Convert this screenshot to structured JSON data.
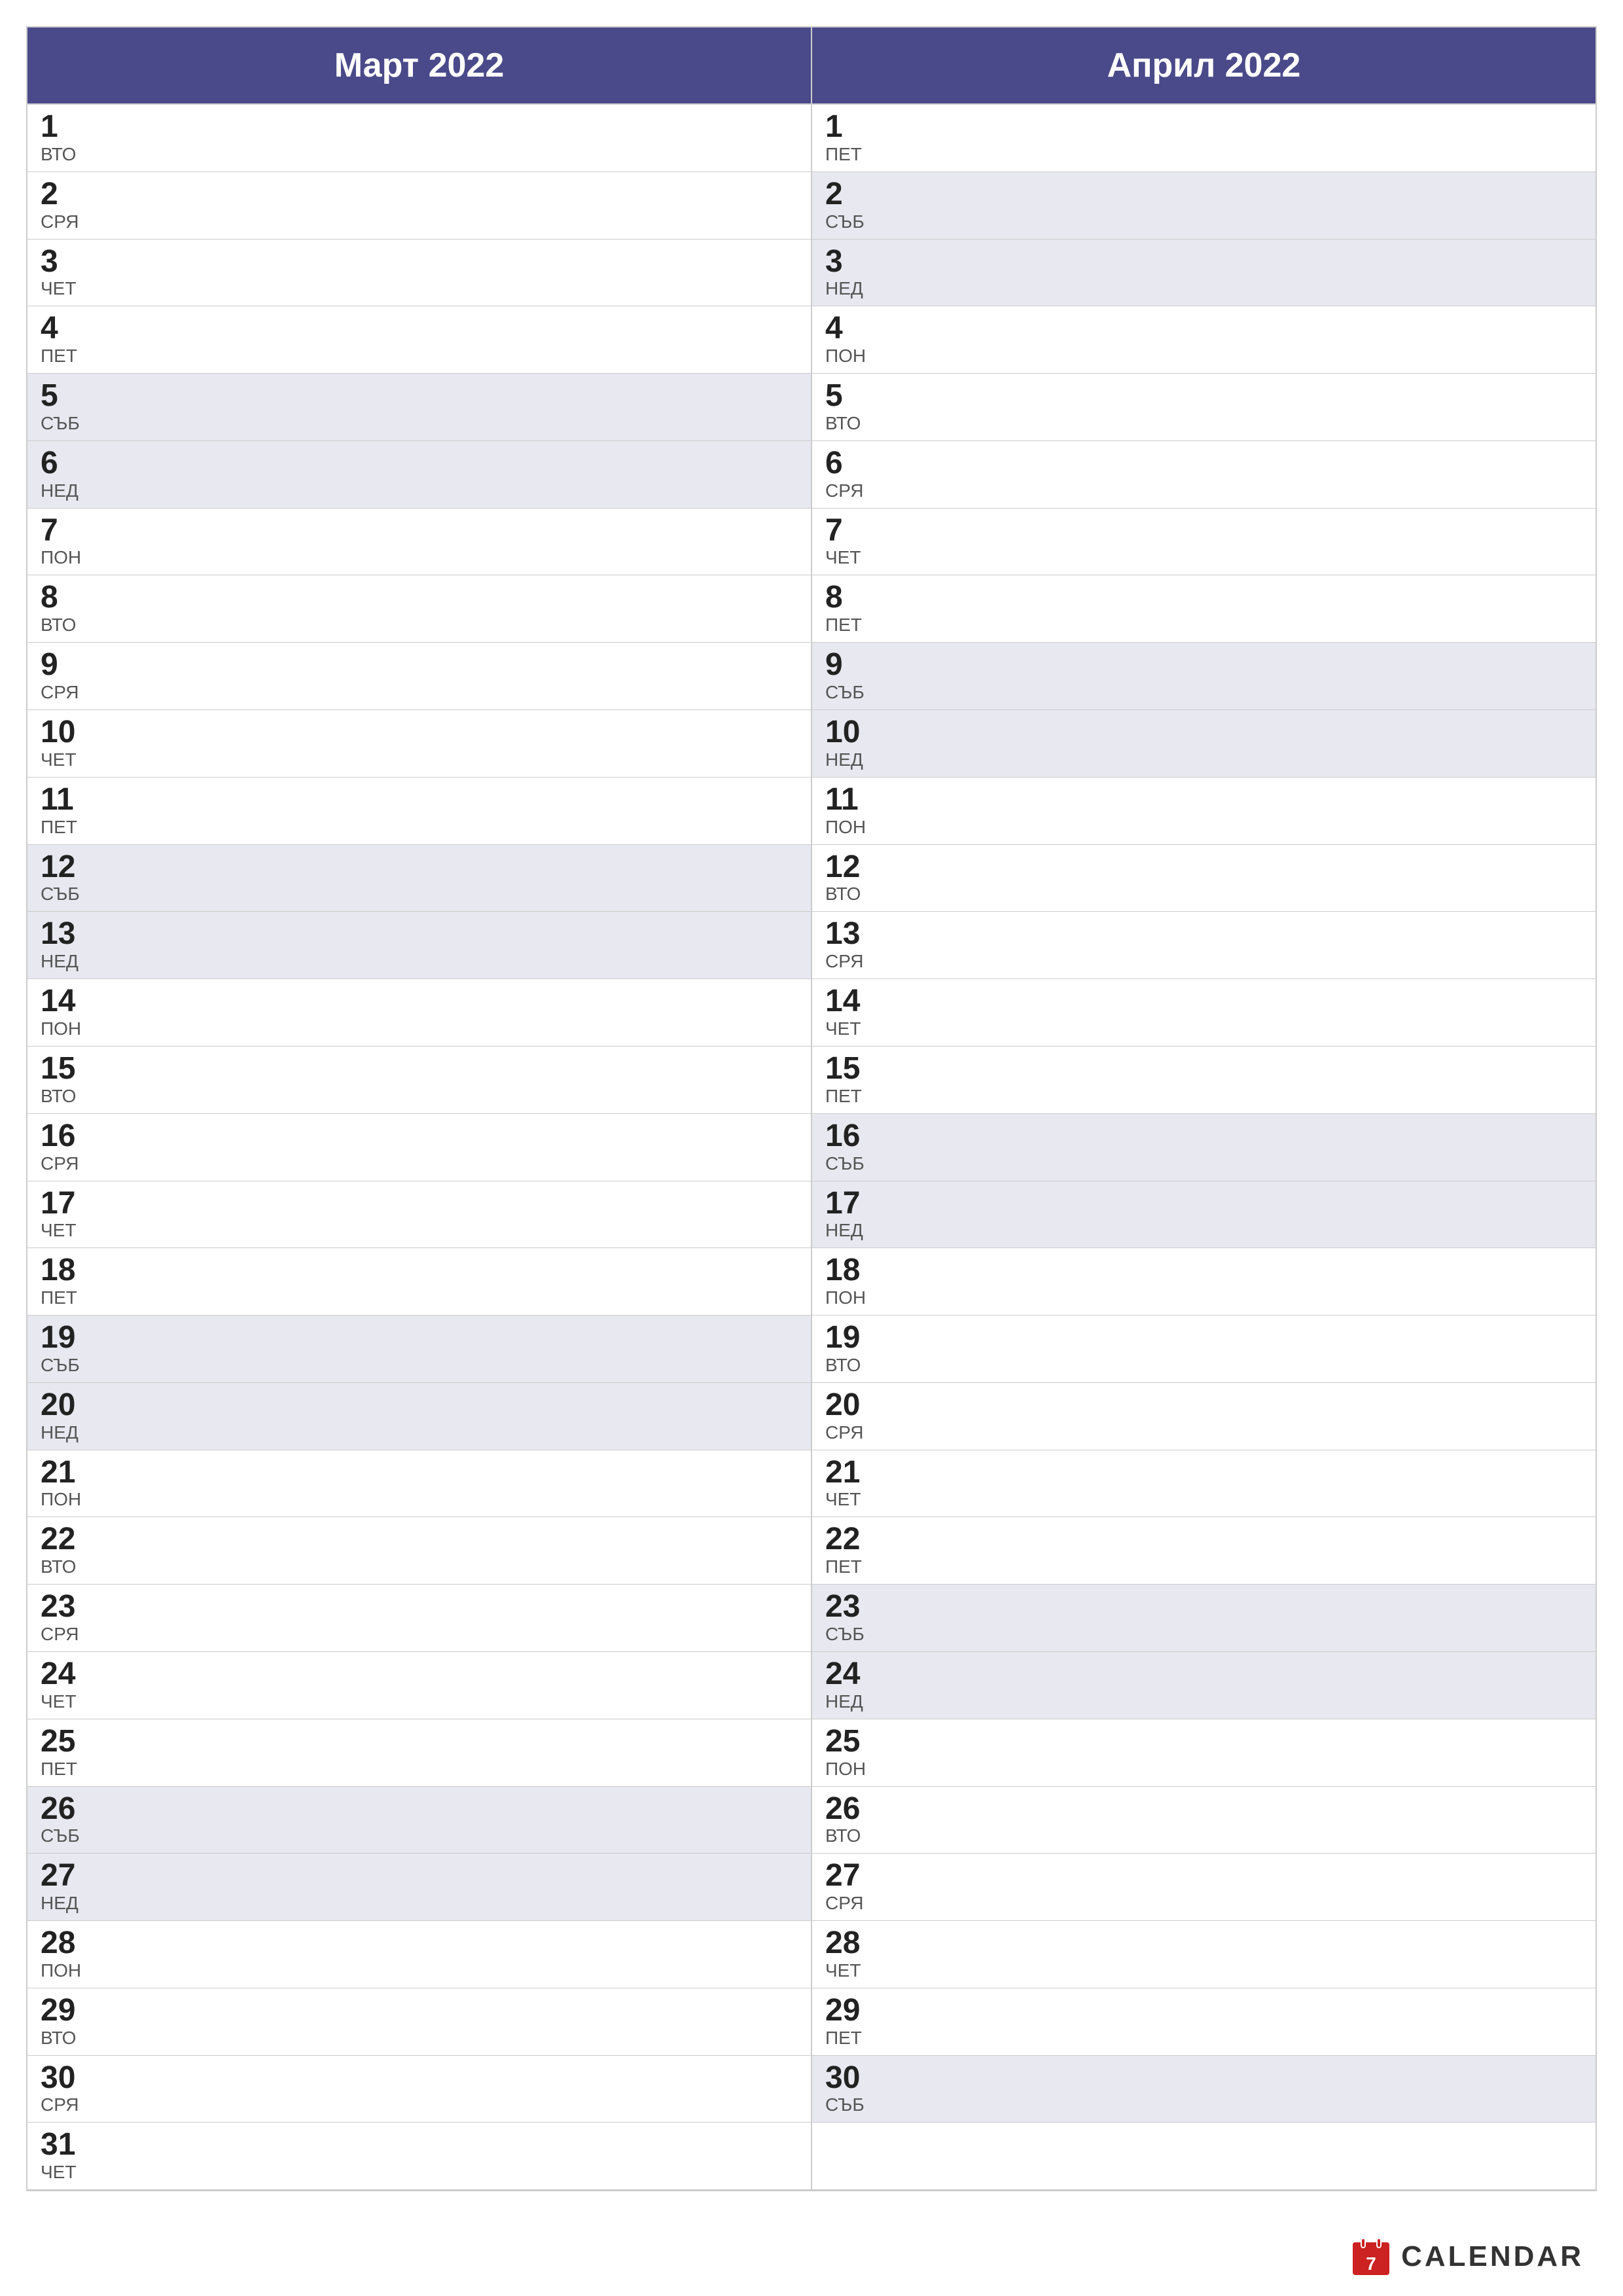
{
  "months": [
    {
      "name": "Март 2022",
      "days": [
        {
          "num": "1",
          "name": "ВТО",
          "weekend": false
        },
        {
          "num": "2",
          "name": "СРЯ",
          "weekend": false
        },
        {
          "num": "3",
          "name": "ЧЕТ",
          "weekend": false
        },
        {
          "num": "4",
          "name": "ПЕТ",
          "weekend": false
        },
        {
          "num": "5",
          "name": "СЪБ",
          "weekend": true
        },
        {
          "num": "6",
          "name": "НЕД",
          "weekend": true
        },
        {
          "num": "7",
          "name": "ПОН",
          "weekend": false
        },
        {
          "num": "8",
          "name": "ВТО",
          "weekend": false
        },
        {
          "num": "9",
          "name": "СРЯ",
          "weekend": false
        },
        {
          "num": "10",
          "name": "ЧЕТ",
          "weekend": false
        },
        {
          "num": "11",
          "name": "ПЕТ",
          "weekend": false
        },
        {
          "num": "12",
          "name": "СЪБ",
          "weekend": true
        },
        {
          "num": "13",
          "name": "НЕД",
          "weekend": true
        },
        {
          "num": "14",
          "name": "ПОН",
          "weekend": false
        },
        {
          "num": "15",
          "name": "ВТО",
          "weekend": false
        },
        {
          "num": "16",
          "name": "СРЯ",
          "weekend": false
        },
        {
          "num": "17",
          "name": "ЧЕТ",
          "weekend": false
        },
        {
          "num": "18",
          "name": "ПЕТ",
          "weekend": false
        },
        {
          "num": "19",
          "name": "СЪБ",
          "weekend": true
        },
        {
          "num": "20",
          "name": "НЕД",
          "weekend": true
        },
        {
          "num": "21",
          "name": "ПОН",
          "weekend": false
        },
        {
          "num": "22",
          "name": "ВТО",
          "weekend": false
        },
        {
          "num": "23",
          "name": "СРЯ",
          "weekend": false
        },
        {
          "num": "24",
          "name": "ЧЕТ",
          "weekend": false
        },
        {
          "num": "25",
          "name": "ПЕТ",
          "weekend": false
        },
        {
          "num": "26",
          "name": "СЪБ",
          "weekend": true
        },
        {
          "num": "27",
          "name": "НЕД",
          "weekend": true
        },
        {
          "num": "28",
          "name": "ПОН",
          "weekend": false
        },
        {
          "num": "29",
          "name": "ВТО",
          "weekend": false
        },
        {
          "num": "30",
          "name": "СРЯ",
          "weekend": false
        },
        {
          "num": "31",
          "name": "ЧЕТ",
          "weekend": false
        }
      ]
    },
    {
      "name": "Април 2022",
      "days": [
        {
          "num": "1",
          "name": "ПЕТ",
          "weekend": false
        },
        {
          "num": "2",
          "name": "СЪБ",
          "weekend": true
        },
        {
          "num": "3",
          "name": "НЕД",
          "weekend": true
        },
        {
          "num": "4",
          "name": "ПОН",
          "weekend": false
        },
        {
          "num": "5",
          "name": "ВТО",
          "weekend": false
        },
        {
          "num": "6",
          "name": "СРЯ",
          "weekend": false
        },
        {
          "num": "7",
          "name": "ЧЕТ",
          "weekend": false
        },
        {
          "num": "8",
          "name": "ПЕТ",
          "weekend": false
        },
        {
          "num": "9",
          "name": "СЪБ",
          "weekend": true
        },
        {
          "num": "10",
          "name": "НЕД",
          "weekend": true
        },
        {
          "num": "11",
          "name": "ПОН",
          "weekend": false
        },
        {
          "num": "12",
          "name": "ВТО",
          "weekend": false
        },
        {
          "num": "13",
          "name": "СРЯ",
          "weekend": false
        },
        {
          "num": "14",
          "name": "ЧЕТ",
          "weekend": false
        },
        {
          "num": "15",
          "name": "ПЕТ",
          "weekend": false
        },
        {
          "num": "16",
          "name": "СЪБ",
          "weekend": true
        },
        {
          "num": "17",
          "name": "НЕД",
          "weekend": true
        },
        {
          "num": "18",
          "name": "ПОН",
          "weekend": false
        },
        {
          "num": "19",
          "name": "ВТО",
          "weekend": false
        },
        {
          "num": "20",
          "name": "СРЯ",
          "weekend": false
        },
        {
          "num": "21",
          "name": "ЧЕТ",
          "weekend": false
        },
        {
          "num": "22",
          "name": "ПЕТ",
          "weekend": false
        },
        {
          "num": "23",
          "name": "СЪБ",
          "weekend": true
        },
        {
          "num": "24",
          "name": "НЕД",
          "weekend": true
        },
        {
          "num": "25",
          "name": "ПОН",
          "weekend": false
        },
        {
          "num": "26",
          "name": "ВТО",
          "weekend": false
        },
        {
          "num": "27",
          "name": "СРЯ",
          "weekend": false
        },
        {
          "num": "28",
          "name": "ЧЕТ",
          "weekend": false
        },
        {
          "num": "29",
          "name": "ПЕТ",
          "weekend": false
        },
        {
          "num": "30",
          "name": "СЪБ",
          "weekend": true
        }
      ]
    }
  ],
  "brand": {
    "text": "CALENDAR",
    "icon_color": "#cc2222"
  }
}
